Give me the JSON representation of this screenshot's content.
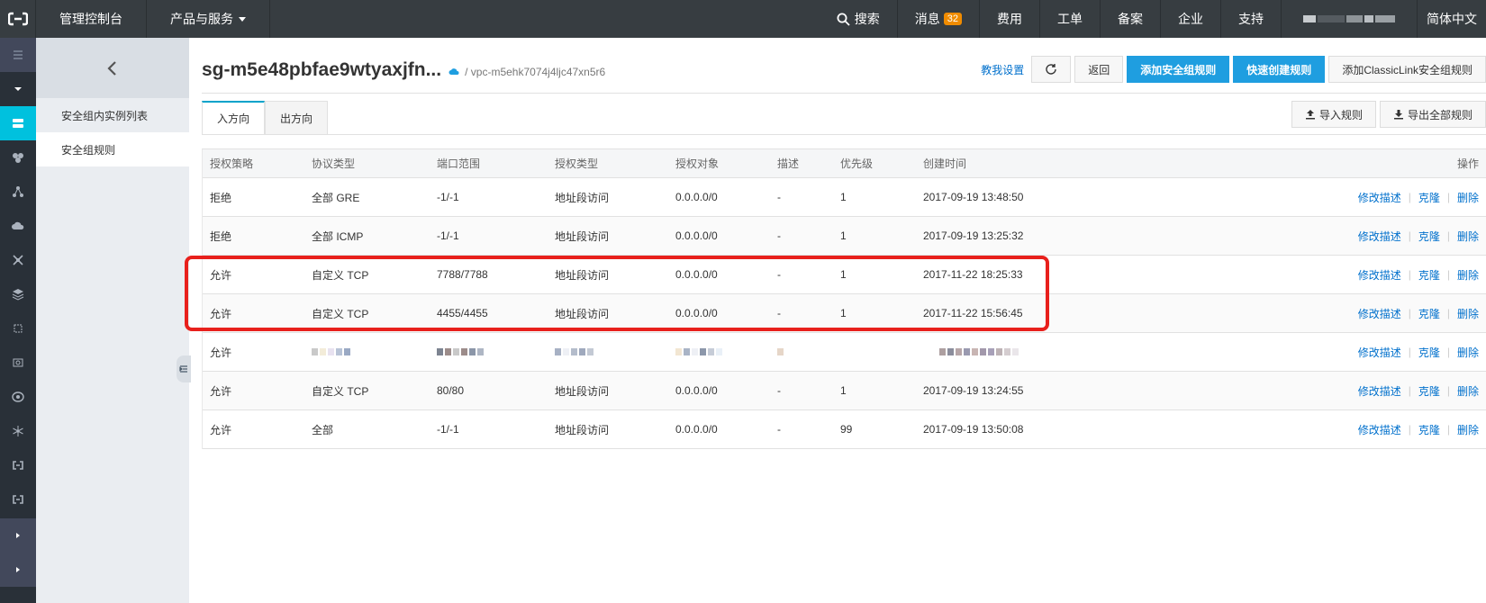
{
  "topbar": {
    "console": "管理控制台",
    "products": "产品与服务",
    "search": "搜索",
    "messages": "消息",
    "message_count": "32",
    "billing": "费用",
    "tickets": "工单",
    "icp": "备案",
    "enterprise": "企业",
    "support": "支持",
    "language": "简体中文"
  },
  "subnav": {
    "items": [
      {
        "label": "安全组内实例列表"
      },
      {
        "label": "安全组规则"
      }
    ]
  },
  "header": {
    "title": "sg-m5e48pbfae9wtyaxjfn...",
    "vpc": "/ vpc-m5ehk7074j4ljc47xn5r6",
    "help_link": "教我设置",
    "back": "返回",
    "add_rule": "添加安全组规则",
    "quick_rule": "快速创建规则",
    "classic_link": "添加ClassicLink安全组规则"
  },
  "tabs": [
    {
      "label": "入方向"
    },
    {
      "label": "出方向"
    }
  ],
  "tab_actions": {
    "import": "导入规则",
    "export": "导出全部规则"
  },
  "table": {
    "columns": [
      "授权策略",
      "协议类型",
      "端口范围",
      "授权类型",
      "授权对象",
      "描述",
      "优先级",
      "创建时间",
      "操作"
    ],
    "ops": {
      "edit": "修改描述",
      "clone": "克隆",
      "delete": "删除"
    },
    "rows": [
      {
        "policy": "拒绝",
        "proto": "全部 GRE",
        "port": "-1/-1",
        "authtype": "地址段访问",
        "target": "0.0.0.0/0",
        "desc": "-",
        "prio": "1",
        "created": "2017-09-19 13:48:50"
      },
      {
        "policy": "拒绝",
        "proto": "全部 ICMP",
        "port": "-1/-1",
        "authtype": "地址段访问",
        "target": "0.0.0.0/0",
        "desc": "-",
        "prio": "1",
        "created": "2017-09-19 13:25:32"
      },
      {
        "policy": "允许",
        "proto": "自定义 TCP",
        "port": "7788/7788",
        "authtype": "地址段访问",
        "target": "0.0.0.0/0",
        "desc": "-",
        "prio": "1",
        "created": "2017-11-22 18:25:33"
      },
      {
        "policy": "允许",
        "proto": "自定义 TCP",
        "port": "4455/4455",
        "authtype": "地址段访问",
        "target": "0.0.0.0/0",
        "desc": "-",
        "prio": "1",
        "created": "2017-11-22 15:56:45"
      },
      {
        "policy": "允许",
        "proto": "",
        "port": "",
        "authtype": "",
        "target": "",
        "desc": "",
        "prio": "",
        "created": ""
      },
      {
        "policy": "允许",
        "proto": "自定义 TCP",
        "port": "80/80",
        "authtype": "地址段访问",
        "target": "0.0.0.0/0",
        "desc": "-",
        "prio": "1",
        "created": "2017-09-19 13:24:55"
      },
      {
        "policy": "允许",
        "proto": "全部",
        "port": "-1/-1",
        "authtype": "地址段访问",
        "target": "0.0.0.0/0",
        "desc": "-",
        "prio": "99",
        "created": "2017-09-19 13:50:08"
      }
    ]
  },
  "colors": {
    "topbar": "#373d41",
    "rail": "#293038",
    "accent": "#00c1de",
    "primary": "#1f9ee0",
    "link": "#0070cc",
    "highlight": "#e8201c"
  }
}
